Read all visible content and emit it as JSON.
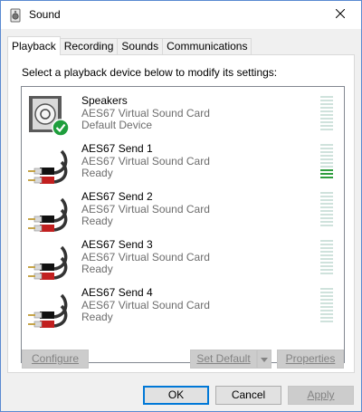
{
  "window": {
    "title": "Sound"
  },
  "tabs": [
    {
      "label": "Playback",
      "active": true
    },
    {
      "label": "Recording",
      "active": false
    },
    {
      "label": "Sounds",
      "active": false
    },
    {
      "label": "Communications",
      "active": false
    }
  ],
  "playback": {
    "prompt": "Select a playback device below to modify its settings:",
    "devices": [
      {
        "name": "Speakers",
        "driver": "AES67 Virtual Sound Card",
        "status": "Default Device",
        "icon": "speaker-icon",
        "is_default": true,
        "level": 0.0
      },
      {
        "name": "AES67 Send 1",
        "driver": "AES67 Virtual Sound Card",
        "status": "Ready",
        "icon": "rca-cable-icon",
        "is_default": false,
        "level": 0.3
      },
      {
        "name": "AES67 Send 2",
        "driver": "AES67 Virtual Sound Card",
        "status": "Ready",
        "icon": "rca-cable-icon",
        "is_default": false,
        "level": 0.0
      },
      {
        "name": "AES67 Send 3",
        "driver": "AES67 Virtual Sound Card",
        "status": "Ready",
        "icon": "rca-cable-icon",
        "is_default": false,
        "level": 0.0
      },
      {
        "name": "AES67 Send 4",
        "driver": "AES67 Virtual Sound Card",
        "status": "Ready",
        "icon": "rca-cable-icon",
        "is_default": false,
        "level": 0.0
      }
    ],
    "buttons": {
      "configure": "Configure",
      "set_default": "Set Default",
      "properties": "Properties"
    }
  },
  "dialog_buttons": {
    "ok": "OK",
    "cancel": "Cancel",
    "apply": "Apply"
  },
  "colors": {
    "meter_idle": "#cfe2dc",
    "meter_active": "#2f9e3f",
    "accent": "#0078d7"
  }
}
